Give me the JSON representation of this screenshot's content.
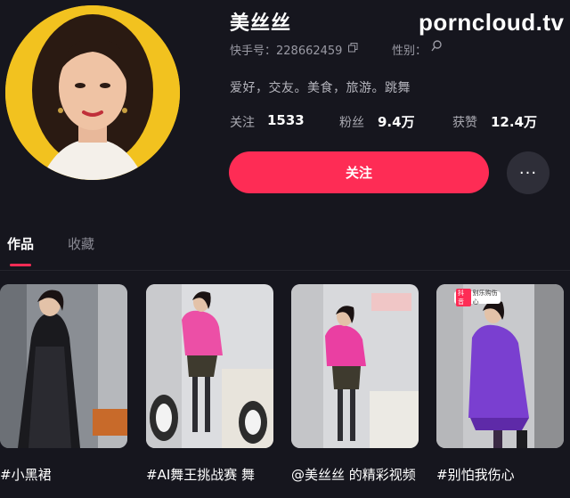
{
  "profile": {
    "name": "美丝丝",
    "id_label": "快手号：228662459",
    "gender_label": "性别：",
    "bio": "爱好，交友。美食，旅游。跳舞",
    "stats": [
      {
        "label": "关注",
        "value": "1533"
      },
      {
        "label": "粉丝",
        "value": "9.4万"
      },
      {
        "label": "获赞",
        "value": "12.4万"
      }
    ]
  },
  "watermark": "porncloud.tv",
  "actions": {
    "follow_label": "关注",
    "more_label": "···"
  },
  "tabs": [
    {
      "label": "作品",
      "active": true
    },
    {
      "label": "收藏",
      "active": false
    }
  ],
  "videos": [
    {
      "caption": "#小黑裙"
    },
    {
      "caption": "#AI舞王挑战赛 舞"
    },
    {
      "caption": "@美丝丝 的精彩视频"
    },
    {
      "caption": "#别怕我伤心",
      "badge_tag": "抖音",
      "badge_text": "别乐购伤心"
    }
  ],
  "colors": {
    "background": "#16161e",
    "accent": "#fe2c55",
    "avatar_bg": "#f2c21f"
  },
  "icons": {
    "copy": "copy-icon",
    "search": "search-icon",
    "more": "more-icon"
  }
}
